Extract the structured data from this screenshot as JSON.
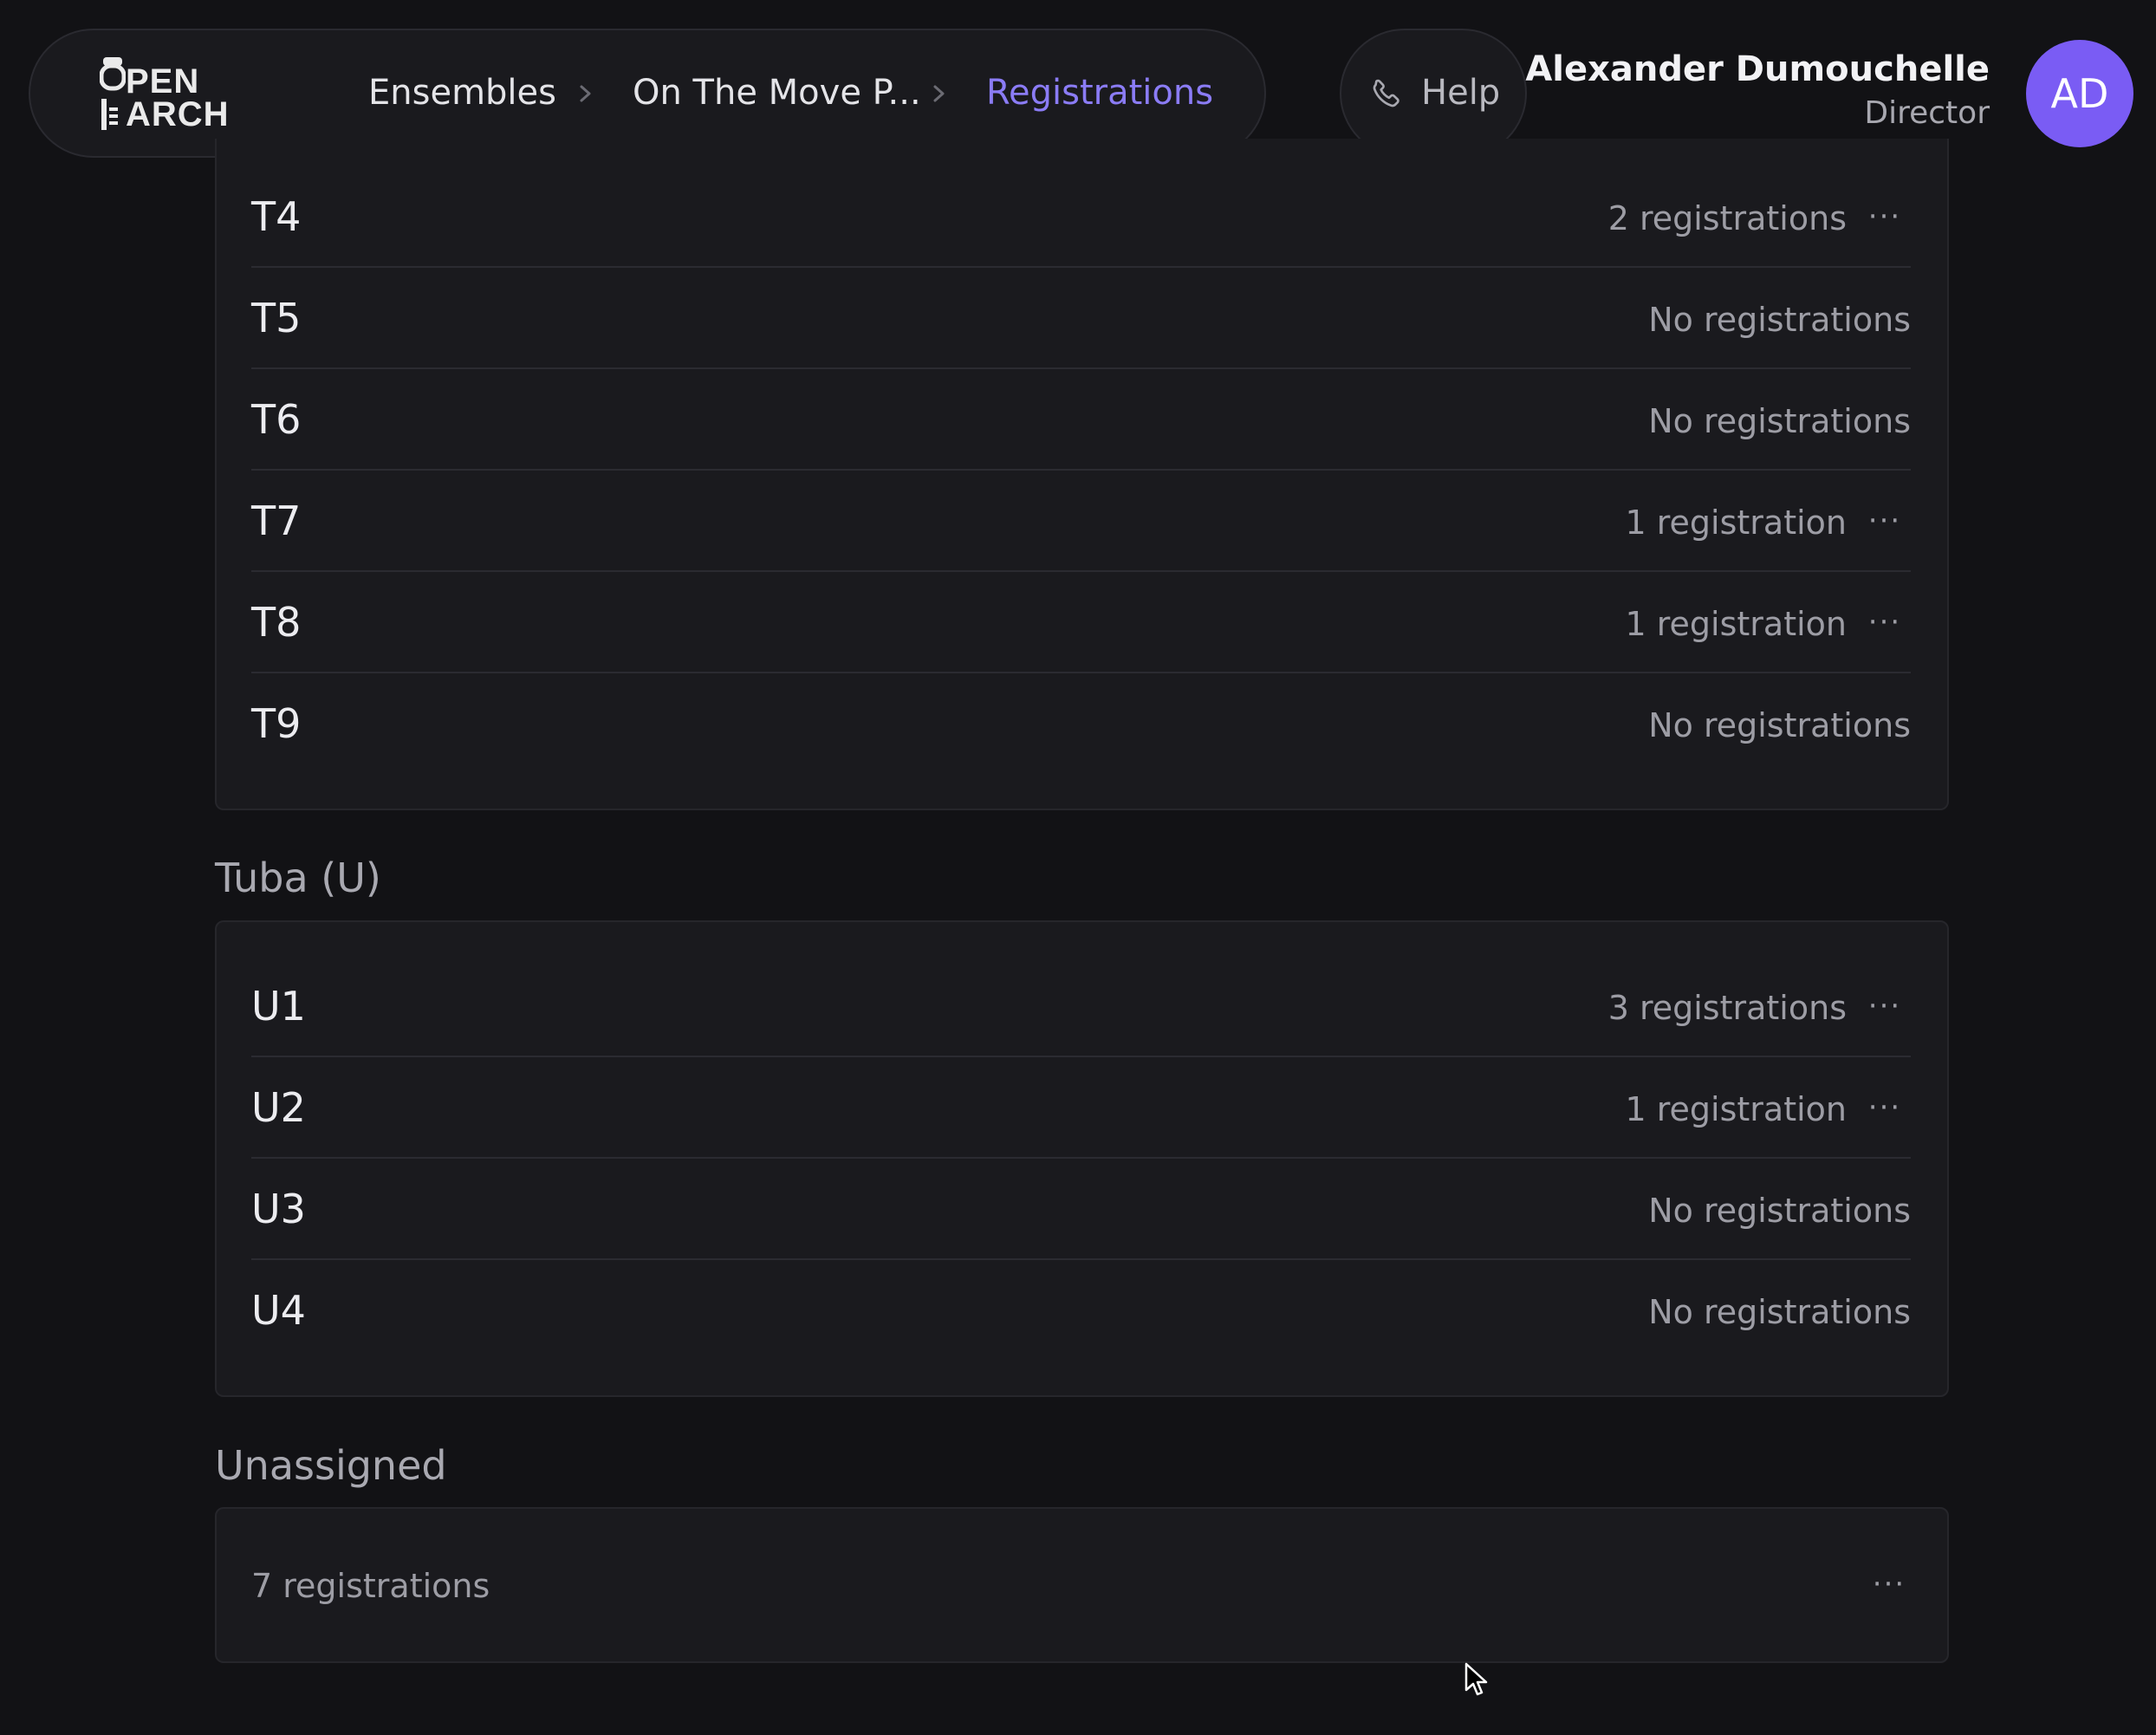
{
  "header": {
    "logo": {
      "line1": "PEN",
      "line2": "ARCH",
      "full": "OPEN MARCH"
    },
    "breadcrumb": [
      "Ensembles",
      "On The Move P...",
      "Registrations"
    ],
    "help_label": "Help",
    "user": {
      "name": "Alexander Dumouchelle",
      "role": "Director",
      "initials": "AD"
    }
  },
  "colors": {
    "background": "#121215",
    "card": "#1a1a1e",
    "accent": "#8b7cf6",
    "avatar": "#7a5cf4",
    "muted_text": "#9d9da5"
  },
  "icons": {
    "chevron": "chevron-right-icon",
    "help": "phone-icon",
    "row_menu": "more-horizontal-icon",
    "cursor": "mouse-pointer-icon"
  },
  "sections": {
    "trombone": {
      "rows": [
        {
          "slot": "T4",
          "count": "2 registrations",
          "menu": "···"
        },
        {
          "slot": "T5",
          "count": "No registrations"
        },
        {
          "slot": "T6",
          "count": "No registrations"
        },
        {
          "slot": "T7",
          "count": "1 registration",
          "menu": "···"
        },
        {
          "slot": "T8",
          "count": "1 registration",
          "menu": "···"
        },
        {
          "slot": "T9",
          "count": "No registrations"
        }
      ]
    },
    "tuba": {
      "title": "Tuba (U)",
      "rows": [
        {
          "slot": "U1",
          "count": "3 registrations",
          "menu": "···"
        },
        {
          "slot": "U2",
          "count": "1 registration",
          "menu": "···"
        },
        {
          "slot": "U3",
          "count": "No registrations"
        },
        {
          "slot": "U4",
          "count": "No registrations"
        }
      ]
    },
    "unassigned": {
      "title": "Unassigned",
      "count": "7 registrations",
      "menu": "···"
    }
  }
}
